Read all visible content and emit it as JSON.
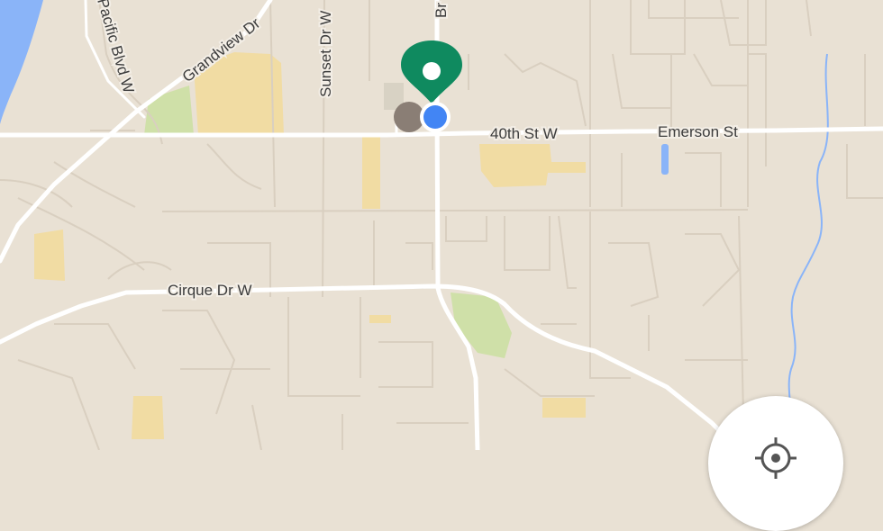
{
  "map": {
    "colors": {
      "land": "#e9e1d4",
      "road": "#ffffff",
      "minor_road": "#d9cfc0",
      "park": "#cfe0a8",
      "building_area": "#f1dca3",
      "water": "#8ab4f8",
      "pin": "#0f8a5f",
      "user_location": "#4285f4"
    },
    "street_labels": [
      "Grandview Dr",
      "Sunset Dr W",
      "Pacific Blvd W",
      "40th St W",
      "Emerson St",
      "Cirque Dr W",
      "Br"
    ]
  },
  "markers": {
    "destination_pin_icon": "map-pin-icon",
    "user_location_icon": "blue-dot-icon",
    "secondary_marker_icon": "gray-place-dot-icon"
  },
  "controls": {
    "locate_icon": "crosshair-icon"
  }
}
